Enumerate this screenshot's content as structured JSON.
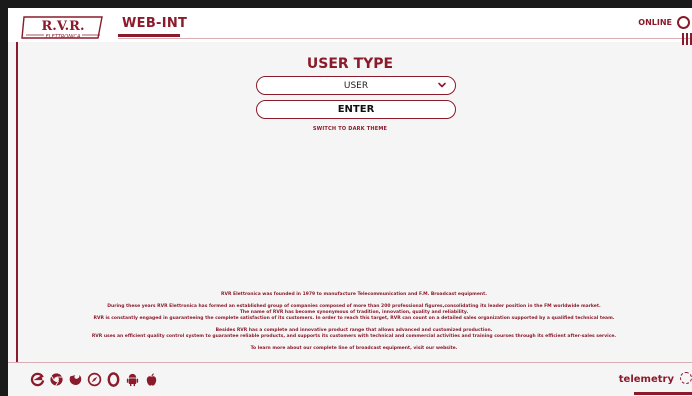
{
  "colors": {
    "brand": "#8b1a2b",
    "background": "#f5f5f5",
    "frame": "#1a1a1a"
  },
  "header": {
    "logo_text": "R.V.R.",
    "logo_subtext": "ELETTRONICA",
    "app_title": "WEB-INT",
    "status": "ONLINE"
  },
  "login": {
    "title": "USER TYPE",
    "selected_user_type": "USER",
    "enter_label": "ENTER",
    "theme_link": "SWITCH TO DARK THEME"
  },
  "about": {
    "line1": "RVR Elettronica was founded in 1979 to manufacture Telecommunication and F.M. Broadcast equipment.",
    "line2": "During these years RVR Elettronica has formed an established group of companies composed of more than 200 professional figures,consolidating its leader position in the FM worldwide market.",
    "line3": "The name of RVR has become synonymous of tradition, innovation, quality and reliability.",
    "line4": "RVR is constantly engaged in guaranteeing the complete satisfaction of its customers. In order to reach this target, RVR can count on a detailed sales organization supported by a qualified technical team.",
    "line5": "Besides RVR has a complete and innovative product range that allows advanced and customized production.",
    "line6": "RVR uses an efficient quality control system to guarantee reliable products, and supports its customers with technical and commercial activities and training courses through its efficient after-sales service.",
    "line7": "To learn more about our complete line of broadcast equipment, visit our website."
  },
  "footer": {
    "browser_icons": [
      "edge-icon",
      "chrome-icon",
      "firefox-icon",
      "safari-icon",
      "opera-icon",
      "android-icon",
      "apple-icon"
    ],
    "telemetry_label": "telemetry"
  }
}
